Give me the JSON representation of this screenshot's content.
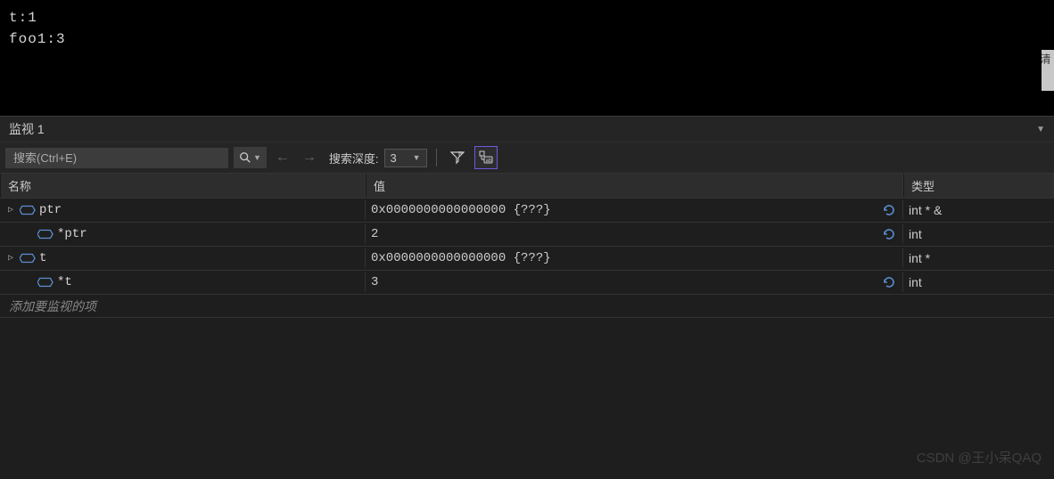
{
  "console": {
    "lines": [
      "t:1",
      "foo1:3"
    ]
  },
  "panel": {
    "title": "监视 1"
  },
  "toolbar": {
    "search_placeholder": "搜索(Ctrl+E)",
    "depth_label": "搜索深度:",
    "depth_value": "3"
  },
  "table": {
    "headers": {
      "name": "名称",
      "value": "值",
      "type": "类型"
    },
    "rows": [
      {
        "expand": true,
        "indent": 0,
        "name": "ptr",
        "value": "0x0000000000000000 {???}",
        "type": "int * &",
        "refresh": true
      },
      {
        "expand": false,
        "indent": 1,
        "name": "*ptr",
        "value": "2",
        "type": "int",
        "refresh": true
      },
      {
        "expand": true,
        "indent": 0,
        "name": "t",
        "value": "0x0000000000000000 {???}",
        "type": "int *",
        "refresh": false
      },
      {
        "expand": false,
        "indent": 1,
        "name": "*t",
        "value": "3",
        "type": "int",
        "refresh": true
      }
    ],
    "add_watch": "添加要监视的项"
  },
  "watermark": "CSDN @王小呆QAQ",
  "side_badge": "清"
}
